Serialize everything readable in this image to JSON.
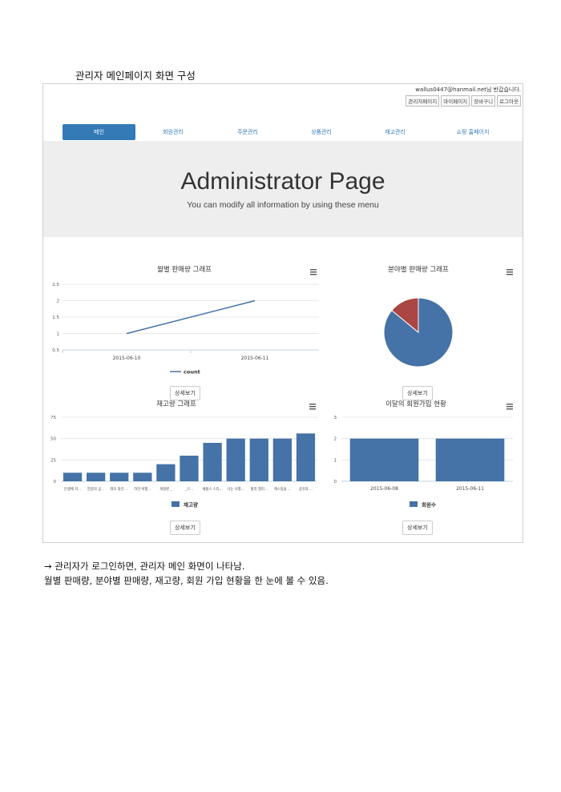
{
  "document": {
    "heading": "관리자 메인페이지 화면 구성",
    "note_line1": "→  관리자가 로그인하면, 관리자 메인 화면이 나타남.",
    "note_line2": "월별 판매량, 분야별 판매량, 재고량, 회원 가입 현황을 한 눈에 볼 수 있음."
  },
  "header": {
    "welcome": "wallus0447@hanmail.net님 반갑습니다.",
    "links": [
      "관리자페이지",
      "마이페이지",
      "장바구니",
      "로그아웃"
    ]
  },
  "nav": {
    "items": [
      "메인",
      "회원관리",
      "주문관리",
      "상품관리",
      "재고관리",
      "쇼핑 홈페이지"
    ]
  },
  "jumbotron": {
    "title": "Administrator Page",
    "subtitle": "You can modify all information by using these menu"
  },
  "buttons": {
    "detail": "상세보기"
  },
  "menu_icon": "hamburger-menu-icon",
  "colors": {
    "primary": "#337ab7",
    "series_blue": "#4572a7",
    "series_red": "#aa4643",
    "jumbotron": "#eeeeee"
  },
  "chart_data": [
    {
      "type": "line",
      "title": "월별 판매량 그래프",
      "x": [
        "2015-06-10",
        "2015-06-11"
      ],
      "series": [
        {
          "name": "count",
          "values": [
            1,
            2
          ]
        }
      ],
      "yticks": [
        "0.5",
        "1",
        "1.5",
        "2",
        "2.5"
      ],
      "ylim": [
        0.5,
        2.5
      ],
      "grid": true,
      "legend": "bottom"
    },
    {
      "type": "pie",
      "title": "분야별 판매량 그래프",
      "slices": [
        {
          "value": 86,
          "color": "#4572a7"
        },
        {
          "value": 14,
          "color": "#aa4643"
        }
      ]
    },
    {
      "type": "bar",
      "title": "재고량 그래프",
      "categories": [
        "인생에 지...",
        "한글의 공...",
        "태조 왕건 ...",
        "하얀 비행...",
        "개정판 _",
        "_구...",
        "채플스 스티...",
        "나는 나를...",
        "빌리 엘리...",
        "캐스팅을 ...",
        "공유의 ..."
      ],
      "series": [
        {
          "name": "재고량",
          "values": [
            10,
            10,
            10,
            10,
            20,
            30,
            45,
            50,
            50,
            50,
            56
          ]
        }
      ],
      "yticks": [
        "0",
        "25",
        "50",
        "75"
      ],
      "ylim": [
        0,
        75
      ],
      "grid": true,
      "legend": "bottom"
    },
    {
      "type": "bar",
      "title": "이달의 회원가입 현황",
      "categories": [
        "2015-06-08",
        "2015-06-11"
      ],
      "series": [
        {
          "name": "회원수",
          "values": [
            2,
            2
          ]
        }
      ],
      "yticks": [
        "0",
        "1",
        "2",
        "3"
      ],
      "ylim": [
        0,
        3
      ],
      "grid": true,
      "legend": "bottom"
    }
  ]
}
